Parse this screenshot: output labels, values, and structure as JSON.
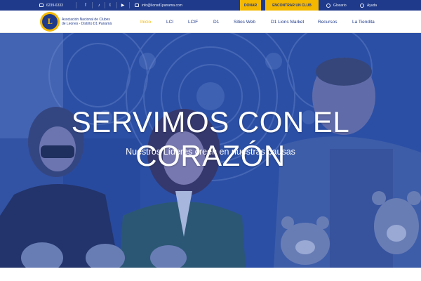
{
  "topbar": {
    "phone": "6239-6333",
    "email": "info@lionsd1panama.com",
    "donate_label": "DONAR",
    "find_club_label": "ENCONTRAR UN CLUB",
    "glossary_label": "Glosario",
    "help_label": "Ayuda",
    "social": [
      {
        "icon": "facebook-icon",
        "glyph": "f"
      },
      {
        "icon": "tiktok-icon",
        "glyph": "♪"
      },
      {
        "icon": "twitter-icon",
        "glyph": "t"
      },
      {
        "icon": "youtube-icon",
        "glyph": "▶"
      }
    ]
  },
  "header": {
    "logo_text": "L",
    "org_name_line1": "Asociación Nacional de Clubes",
    "org_name_line2": "de Leones  - Distrito D1 Panamá"
  },
  "nav": [
    {
      "label": "Inicio",
      "active": true
    },
    {
      "label": "LCI",
      "active": false
    },
    {
      "label": "LCIF",
      "active": false
    },
    {
      "label": "D1",
      "active": false
    },
    {
      "label": "Sitios Web",
      "active": false
    },
    {
      "label": "D1 Lions Market",
      "active": false
    },
    {
      "label": "Recursos",
      "active": false
    },
    {
      "label": "La Tiendita",
      "active": false
    }
  ],
  "hero": {
    "title": "SERVIMOS CON EL CORAZÓN",
    "subtitle": "Nuestros Líderes creen en nuestras causas"
  },
  "colors": {
    "brand_blue": "#1f3a8a",
    "accent_yellow": "#f5b800",
    "hero_overlay": "#2c4ea0"
  }
}
